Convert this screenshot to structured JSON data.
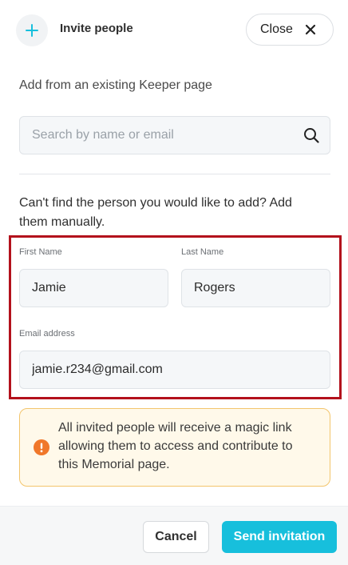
{
  "header": {
    "title": "Invite people",
    "add_icon": "plus-icon",
    "close_label": "Close",
    "close_icon": "x-icon"
  },
  "search": {
    "section_label": "Add from an existing Keeper page",
    "placeholder": "Search by name or email",
    "value": "",
    "icon": "search-icon"
  },
  "manual": {
    "prompt": "Can't find the person you would like to add? Add them manually.",
    "first_name_label": "First Name",
    "first_name_value": "Jamie",
    "last_name_label": "Last Name",
    "last_name_value": "Rogers",
    "email_label": "Email address",
    "email_value": "jamie.r234@gmail.com"
  },
  "notice": {
    "icon": "exclamation-circle-icon",
    "text": "All invited people will receive a magic link allowing them to access and contribute to this Memorial page."
  },
  "footer": {
    "cancel_label": "Cancel",
    "send_label": "Send invitation"
  },
  "colors": {
    "accent": "#17bfdc",
    "highlight": "#b3111c",
    "warning": "#f0772a",
    "notice_border": "#f3c56c",
    "notice_bg": "#fff9ea"
  }
}
